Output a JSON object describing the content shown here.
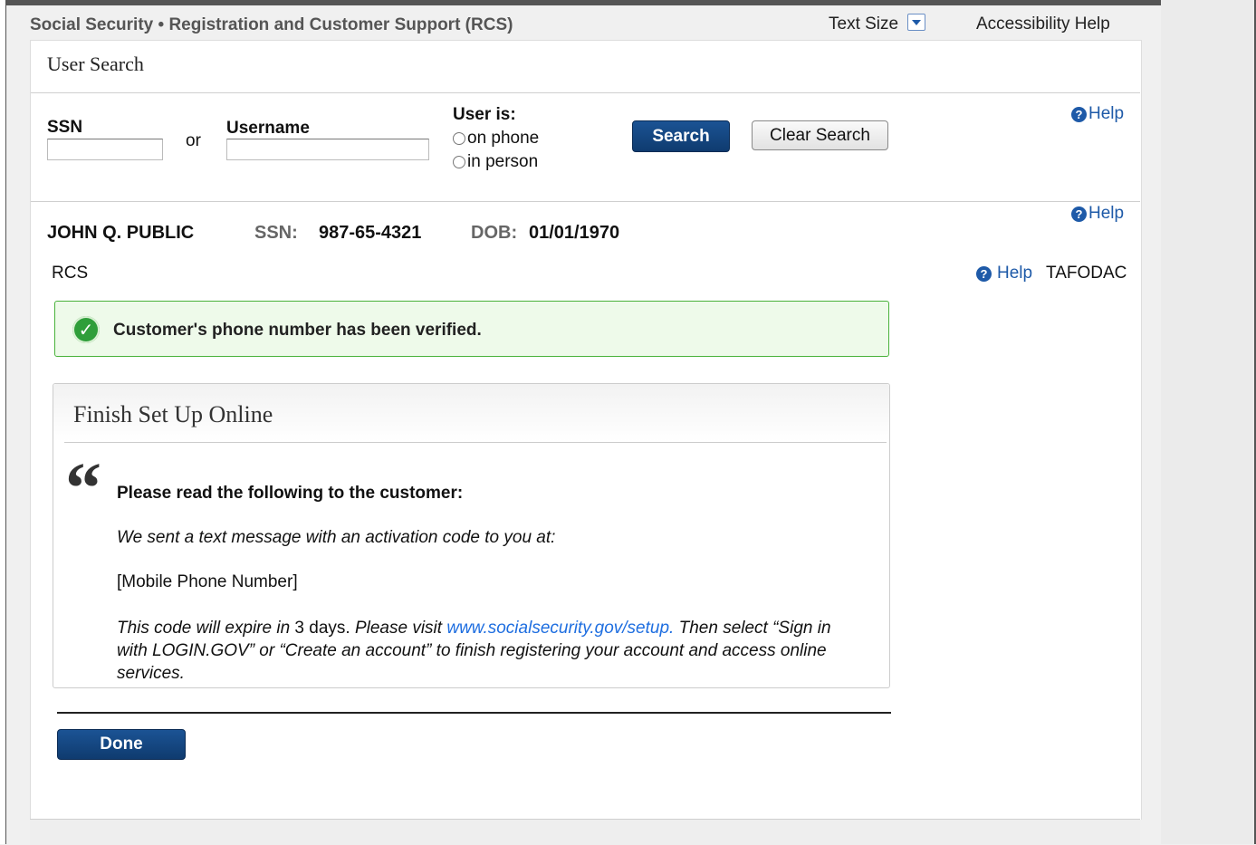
{
  "header": {
    "app_title": "Social Security • Registration and Customer Support (RCS)",
    "text_size_label": "Text Size",
    "accessibility_help": "Accessibility Help"
  },
  "card": {
    "title": "User Search"
  },
  "search": {
    "ssn_label": "SSN",
    "ssn_value": "",
    "or_label": "or",
    "username_label": "Username",
    "username_value": "",
    "user_is_label": "User is:",
    "radio_options": [
      "on phone",
      "in person"
    ],
    "search_button": "Search",
    "clear_button": "Clear Search",
    "help_label": "Help"
  },
  "customer": {
    "name": "JOHN Q. PUBLIC",
    "ssn_label": "SSN:",
    "ssn_value": "987-65-4321",
    "dob_label": "DOB:",
    "dob_value": "01/01/1970",
    "help_label": "Help"
  },
  "context": {
    "left_label": "RCS",
    "help_label": "Help",
    "right_label": "TAFODAC"
  },
  "alert": {
    "message": "Customer's phone number has been verified.",
    "color": "#49b23b"
  },
  "panel": {
    "title": "Finish Set Up Online",
    "quote_glyph": "“",
    "lead": "Please read the following to the customer:",
    "line1": "We sent a text message with an activation code to you at:",
    "line2": "[Mobile Phone Number]",
    "expire_pre": "This code will expire in ",
    "expire_days": "3 days.",
    "visit_text": " Please visit ",
    "link_text": "www.socialsecurity.gov/setup.",
    "after_link": " Then select “Sign in with LOGIN.GOV” or “Create an account” to finish registering your account and access online services."
  },
  "footer": {
    "done_button": "Done"
  },
  "colors": {
    "primary_button": "#0f3b6f",
    "link": "#1e6ee0",
    "help": "#1e5aa8"
  }
}
